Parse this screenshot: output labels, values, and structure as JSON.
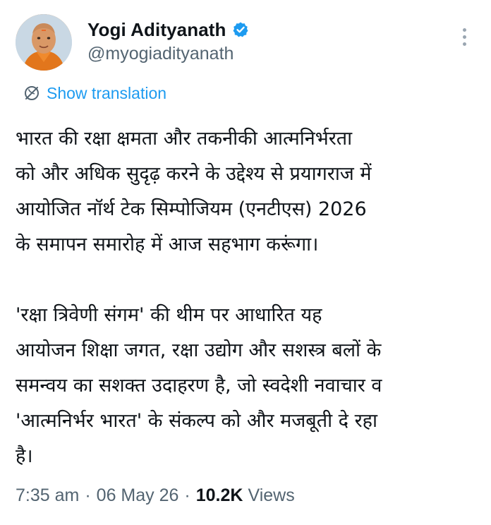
{
  "author": {
    "name": "Yogi Adityanath",
    "handle": "@myogiadityanath",
    "verified": true,
    "avatar_icon": "profile-avatar"
  },
  "translate": {
    "icon": "globe-icon",
    "label": "Show translation",
    "color": "#1d9bf0"
  },
  "tweet": {
    "paragraph_1": "भारत की रक्षा क्षमता और तकनीकी आत्मनिर्भरता\nको और अधिक सुदृढ़ करने के उद्देश्य से प्रयागराज में\nआयोजित नॉर्थ टेक सिम्पोजियम (एनटीएस) 2026\nके समापन समारोह में आज सहभाग करूंगा।",
    "paragraph_2": "'रक्षा त्रिवेणी संगम' की थीम पर आधारित यह\nआयोजन शिक्षा जगत, रक्षा उद्योग और सशस्त्र बलों के\nसमन्वय का सशक्त उदाहरण है, जो स्वदेशी नवाचार व\n'आत्मनिर्भर भारत' के संकल्प को और मजबूती दे रहा\nहै।"
  },
  "meta": {
    "time": "7:35 am",
    "separator": "·",
    "date": "06 May 26",
    "views_count": "10.2K",
    "views_label": "Views"
  },
  "colors": {
    "verified_badge": "#1d9bf0",
    "secondary_text": "#536471",
    "primary_text": "#0f1419"
  }
}
